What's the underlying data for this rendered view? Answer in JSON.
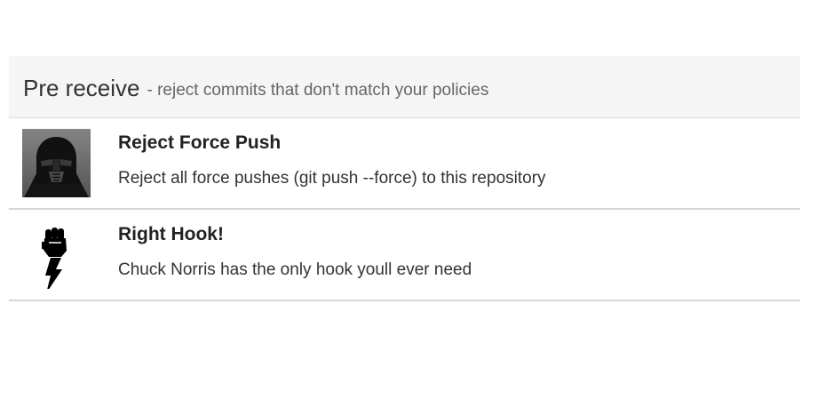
{
  "header": {
    "title": "Pre receive",
    "subtitle": "- reject commits that don't match your policies"
  },
  "hooks": [
    {
      "name": "Reject Force Push",
      "description": "Reject all force pushes (git push --force) to this repository",
      "icon": "darth-vader-icon"
    },
    {
      "name": "Right Hook!",
      "description": "Chuck Norris has the only hook youll ever need",
      "icon": "fist-lightning-icon"
    }
  ]
}
